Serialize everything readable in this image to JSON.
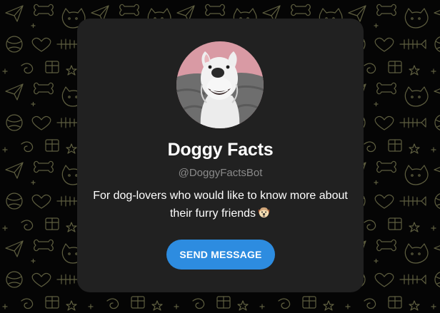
{
  "bot": {
    "name": "Doggy Facts",
    "username": "@DoggyFactsBot",
    "description": "For dog-lovers who would like to know more about their furry friends",
    "description_emoji": "dog-face-emoji"
  },
  "actions": {
    "send_label": "SEND MESSAGE"
  },
  "colors": {
    "background": "#050505",
    "doodle_pattern": "#c8c88a",
    "card": "#212121",
    "accent_button": "#2d8ce0",
    "username_text": "#8a8a8a"
  },
  "icons": [
    "bot-avatar",
    "dog-face-emoji",
    "background-doodle-pattern"
  ]
}
